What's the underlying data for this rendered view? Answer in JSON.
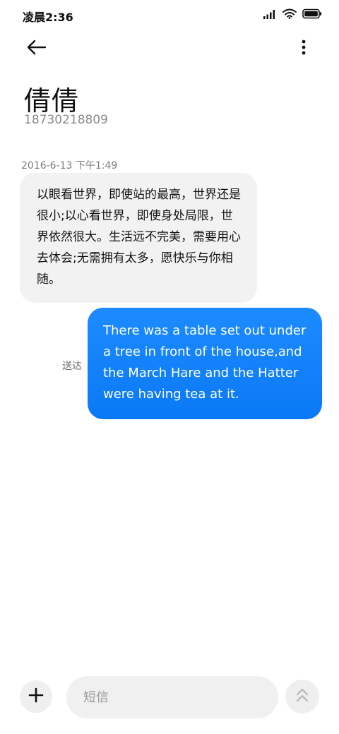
{
  "status_bar": {
    "time": "凌晨2:36",
    "icons": [
      "signal-icon",
      "wifi-icon",
      "battery-icon"
    ]
  },
  "header": {
    "back_icon": "back-arrow-icon",
    "menu_icon": "more-vertical-icon",
    "contact_name": "倩倩",
    "contact_number": "18730218809"
  },
  "conversation": {
    "timestamp": "2016-6-13 下午1:49",
    "messages": [
      {
        "direction": "incoming",
        "text": "以眼看世界，即使站的最高，世界还是很小;以心看世界，即使身处局限，世界依然很大。生活远不完美，需要用心去体会;无需拥有太多，愿快乐与你相随。"
      },
      {
        "direction": "outgoing",
        "text": "There was a table set out under a tree in front of the house,and the March Hare and the Hatter were having tea at it.",
        "status": "送达"
      }
    ]
  },
  "composer": {
    "add_icon": "plus-icon",
    "placeholder": "短信",
    "value": "",
    "send_icon": "double-chevron-up-icon"
  },
  "colors": {
    "outgoing_bubble": "#0a79f5",
    "incoming_bubble": "#f2f2f3",
    "secondary_text": "#8a8a8a"
  }
}
